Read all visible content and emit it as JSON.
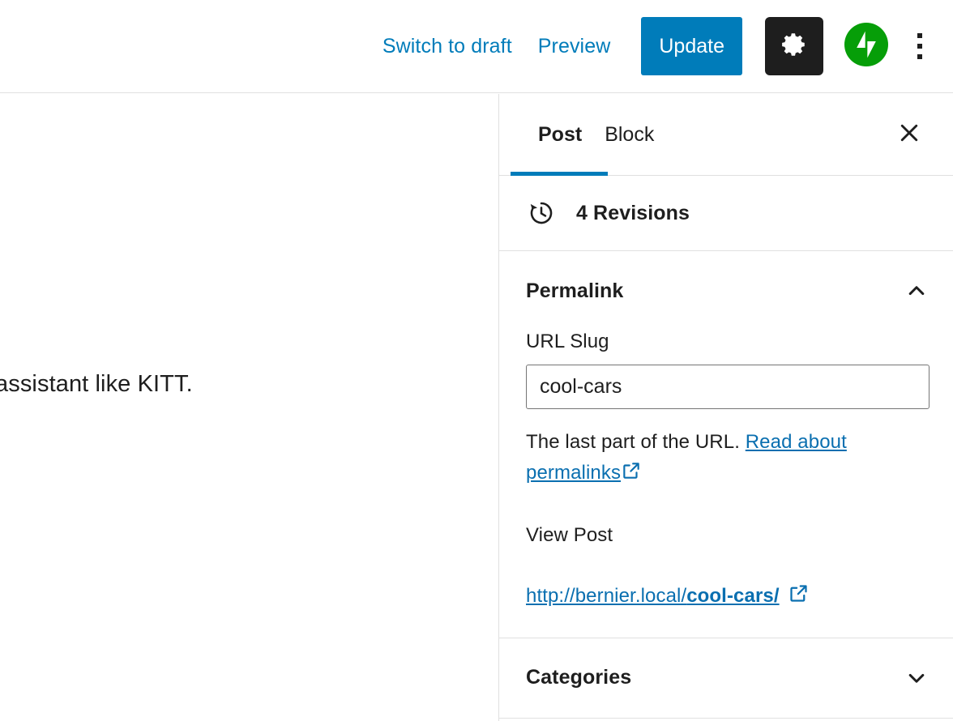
{
  "header": {
    "switch_to_draft": "Switch to draft",
    "preview": "Preview",
    "update": "Update",
    "settings_icon": "gear-icon",
    "jetpack_icon": "jetpack-icon",
    "more_options_icon": "kebab-menu-icon",
    "accent_color": "#007cba",
    "settings_button_bg": "#1e1e1e",
    "jetpack_color": "#069e08"
  },
  "editor": {
    "paragraph_text": "assistant like KITT."
  },
  "sidebar": {
    "tabs": [
      {
        "label": "Post",
        "active": true
      },
      {
        "label": "Block",
        "active": false
      }
    ],
    "close_icon": "close-icon",
    "revisions": {
      "label": "4 Revisions",
      "icon": "revisions-clock-icon",
      "count": 4
    },
    "permalink_panel": {
      "title": "Permalink",
      "expanded": true,
      "chevron_icon": "chevron-up-icon",
      "url_slug_label": "URL Slug",
      "url_slug_value": "cool-cars",
      "url_slug_placeholder": "cool-cars",
      "help_prefix": "The last part of the URL.",
      "help_link_text": "Read about permalinks",
      "help_link_icon": "external-link-icon",
      "view_post_label": "View Post",
      "permalink_base": "http://bernier.local/",
      "permalink_slug": "cool-cars/",
      "permalink_icon": "external-link-icon"
    },
    "categories_panel": {
      "title": "Categories",
      "expanded": false,
      "chevron_icon": "chevron-down-icon"
    }
  }
}
